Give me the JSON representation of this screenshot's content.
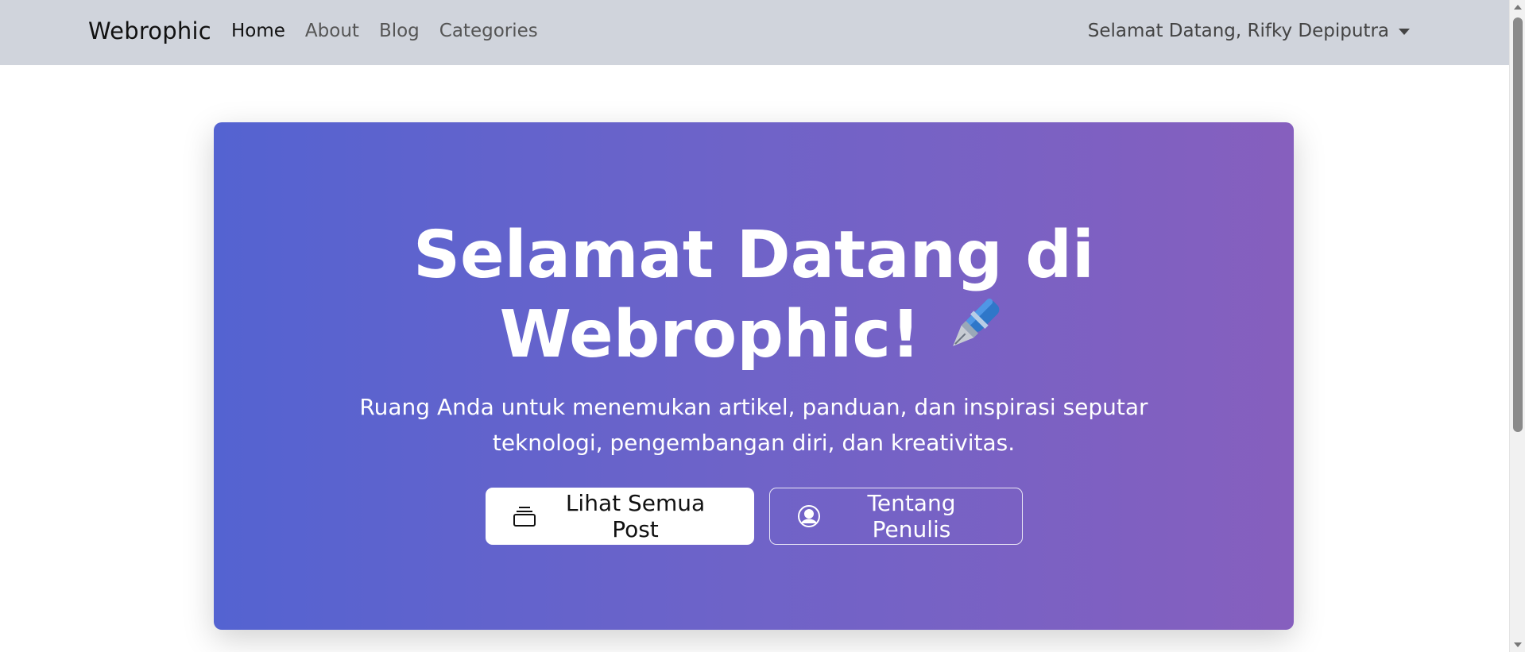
{
  "navbar": {
    "brand": "Webrophic",
    "links": [
      {
        "label": "Home",
        "active": true
      },
      {
        "label": "About",
        "active": false
      },
      {
        "label": "Blog",
        "active": false
      },
      {
        "label": "Categories",
        "active": false
      }
    ],
    "user_menu": "Selamat Datang, Rifky Depiputra"
  },
  "hero": {
    "title_line1": "Selamat Datang di",
    "title_line2": "Webrophic!",
    "subtitle": "Ruang Anda untuk menemukan artikel, panduan, dan inspirasi seputar teknologi, pengembangan diri, dan kreativitas.",
    "buttons": {
      "primary": "Lihat Semua Post",
      "secondary": "Tentang Penulis"
    },
    "icons": {
      "pen": "fountain-pen-icon",
      "primary": "collection-icon",
      "secondary": "user-circle-icon"
    }
  },
  "colors": {
    "navbar_bg": "#d0d4dc",
    "hero_start": "#5463d1",
    "hero_end": "#865fbe"
  }
}
